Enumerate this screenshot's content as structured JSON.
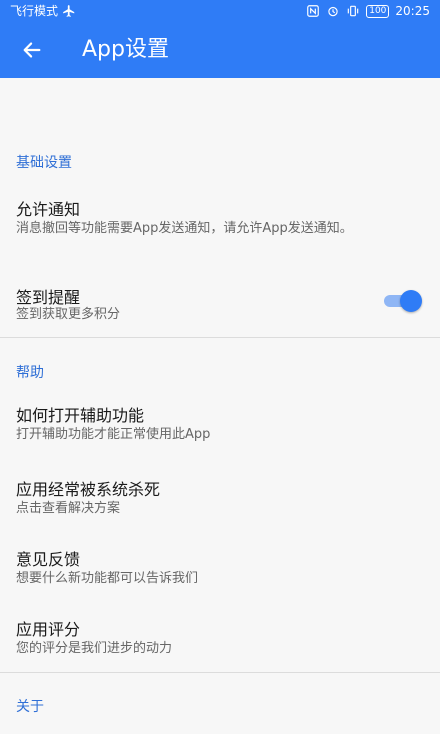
{
  "status_bar": {
    "mode_label": "飞行模式",
    "airplane_icon": "airplane-icon",
    "battery": "100",
    "time": "20:25"
  },
  "header": {
    "title": "App设置",
    "back_icon": "back-arrow-icon"
  },
  "sections": {
    "basic": {
      "title": "基础设置",
      "allow_notify": {
        "title": "允许通知",
        "subtitle": "消息撤回等功能需要App发送通知，请允许App发送通知。"
      },
      "sign_reminder": {
        "title": "签到提醒",
        "subtitle": "签到获取更多积分",
        "enabled": true
      }
    },
    "help": {
      "title": "帮助",
      "open_accessibility": {
        "title": "如何打开辅助功能",
        "subtitle": "打开辅助功能才能正常使用此App"
      },
      "killed_by_system": {
        "title": "应用经常被系统杀死",
        "subtitle": "点击查看解决方案"
      },
      "feedback": {
        "title": "意见反馈",
        "subtitle": "想要什么新功能都可以告诉我们"
      },
      "rate_app": {
        "title": "应用评分",
        "subtitle": "您的评分是我们进步的动力"
      }
    },
    "about": {
      "title": "关于"
    }
  },
  "colors": {
    "primary": "#2f7cf6",
    "section_title": "#2f6fd6",
    "background": "#f7f7f7"
  }
}
